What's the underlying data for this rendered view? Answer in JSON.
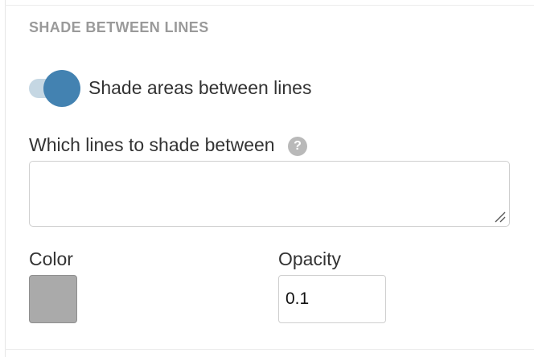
{
  "section": {
    "title": "SHADE BETWEEN LINES"
  },
  "shade_toggle": {
    "label": "Shade areas between lines",
    "enabled": true,
    "track_color": "#c5d7e3",
    "knob_color": "#4382b1"
  },
  "lines_field": {
    "label": "Which lines to shade between",
    "help_icon_glyph": "?",
    "value": ""
  },
  "color_field": {
    "label": "Color",
    "value": "#aaaaaa"
  },
  "opacity_field": {
    "label": "Opacity",
    "value": "0.1"
  }
}
